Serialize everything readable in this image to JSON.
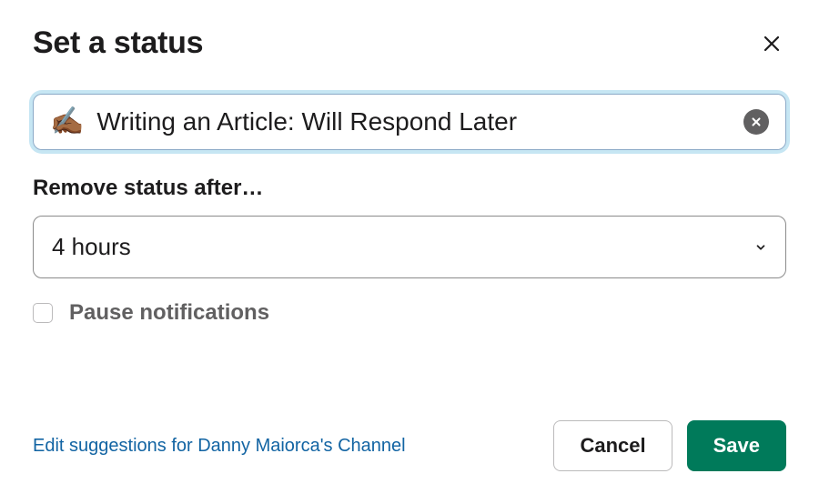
{
  "header": {
    "title": "Set a status"
  },
  "status": {
    "emoji": "✍🏾",
    "text": "Writing an Article: Will Respond Later"
  },
  "duration": {
    "label": "Remove status after…",
    "selected": "4 hours"
  },
  "pause": {
    "label": "Pause notifications",
    "checked": false
  },
  "footer": {
    "edit_link": "Edit suggestions for Danny Maiorca's Channel",
    "cancel": "Cancel",
    "save": "Save"
  }
}
